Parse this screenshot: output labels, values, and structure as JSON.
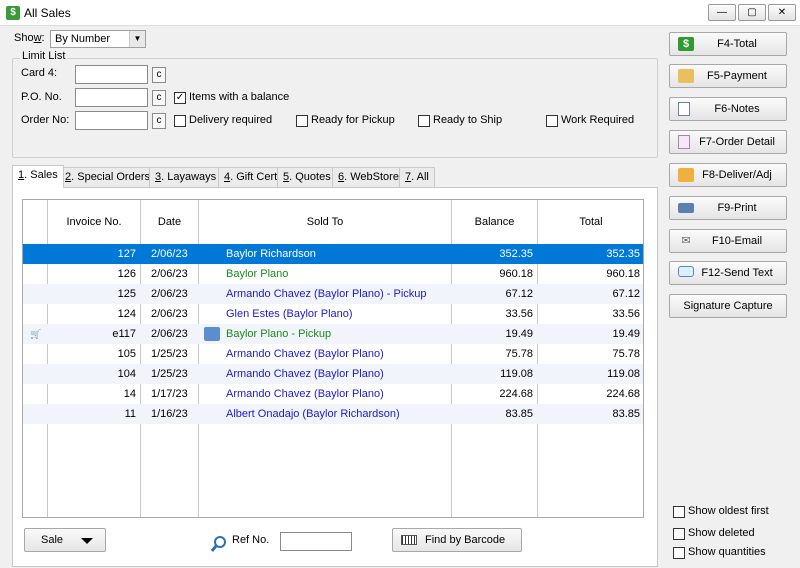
{
  "window": {
    "title": "All Sales",
    "app_icon": "$"
  },
  "show": {
    "label": "Show:",
    "selected": "By Number"
  },
  "limit_list": {
    "legend": "Limit List",
    "card_label": "Card 4:",
    "po_label": "P.O. No.",
    "order_label": "Order No:",
    "clear_btn": "c",
    "items_with_balance": {
      "label": "Items with a balance",
      "checked": true
    },
    "delivery_required": {
      "label": "Delivery required",
      "checked": false
    },
    "ready_for_pickup": {
      "label": "Ready for Pickup",
      "checked": false
    },
    "ready_to_ship": {
      "label": "Ready to Ship",
      "checked": false
    },
    "work_required": {
      "label": "Work Required",
      "checked": false
    }
  },
  "tabs": [
    {
      "key": "1",
      "label": ". Sales"
    },
    {
      "key": "2",
      "label": ". Special Orders"
    },
    {
      "key": "3",
      "label": ". Layaways"
    },
    {
      "key": "4",
      "label": ". Gift Cert"
    },
    {
      "key": "5",
      "label": ". Quotes"
    },
    {
      "key": "6",
      "label": ". WebStore"
    },
    {
      "key": "7",
      "label": ". All"
    }
  ],
  "table": {
    "columns": [
      "Invoice No.",
      "Date",
      "Sold To",
      "Balance",
      "Total"
    ],
    "rows": [
      {
        "invoice": "127",
        "date": "2/06/23",
        "sold_to": "Baylor Richardson",
        "balance": "352.35",
        "total": "352.35",
        "color": "#ffffff"
      },
      {
        "invoice": "126",
        "date": "2/06/23",
        "sold_to": "Baylor Plano",
        "balance": "960.18",
        "total": "960.18",
        "color": "#1a8a1a"
      },
      {
        "invoice": "125",
        "date": "2/06/23",
        "sold_to": "Armando Chavez (Baylor Plano) - Pickup",
        "balance": "67.12",
        "total": "67.12",
        "color": "#1a1ad0"
      },
      {
        "invoice": "124",
        "date": "2/06/23",
        "sold_to": "Glen Estes (Baylor Plano)",
        "balance": "33.56",
        "total": "33.56",
        "color": "#1a1ad0"
      },
      {
        "invoice": "e117",
        "date": "2/06/23",
        "sold_to": "Baylor Plano - Pickup",
        "balance": "19.49",
        "total": "19.49",
        "color": "#1a8a1a",
        "web": true
      },
      {
        "invoice": "105",
        "date": "1/25/23",
        "sold_to": "Armando Chavez (Baylor Plano)",
        "balance": "75.78",
        "total": "75.78",
        "color": "#1a1ad0"
      },
      {
        "invoice": "104",
        "date": "1/25/23",
        "sold_to": "Armando Chavez (Baylor Plano)",
        "balance": "119.08",
        "total": "119.08",
        "color": "#1a1ad0"
      },
      {
        "invoice": "14",
        "date": "1/17/23",
        "sold_to": "Armando Chavez (Baylor Plano)",
        "balance": "224.68",
        "total": "224.68",
        "color": "#1a1ad0"
      },
      {
        "invoice": "11",
        "date": "1/16/23",
        "sold_to": "Albert Onadajo (Baylor Richardson)",
        "balance": "83.85",
        "total": "83.85",
        "color": "#1a1ad0"
      }
    ]
  },
  "bottom": {
    "sale_button": "Sale",
    "ref_label": "Ref No.",
    "ref_value": "",
    "barcode_button": "Find by Barcode"
  },
  "side_buttons": [
    {
      "label": "F4-Total",
      "icon": "dollar-icon"
    },
    {
      "label": "F5-Payment",
      "icon": "payment-icon"
    },
    {
      "label": "F6-Notes",
      "icon": "notes-icon"
    },
    {
      "label": "F7-Order Detail",
      "icon": "calculator-icon"
    },
    {
      "label": "F8-Deliver/Adj",
      "icon": "deliver-icon"
    },
    {
      "label": "F9-Print",
      "icon": "printer-icon"
    },
    {
      "label": "F10-Email",
      "icon": "envelope-icon"
    },
    {
      "label": "F12-Send Text",
      "icon": "chat-icon"
    },
    {
      "label": "Signature Capture",
      "icon": ""
    }
  ],
  "options": {
    "oldest_first": "Show oldest first",
    "show_deleted": "Show deleted",
    "show_quantities": "Show quantities"
  },
  "colors": {
    "selection": "#0078d7",
    "link_blue": "#1a1ad0",
    "green": "#1a8a1a"
  }
}
